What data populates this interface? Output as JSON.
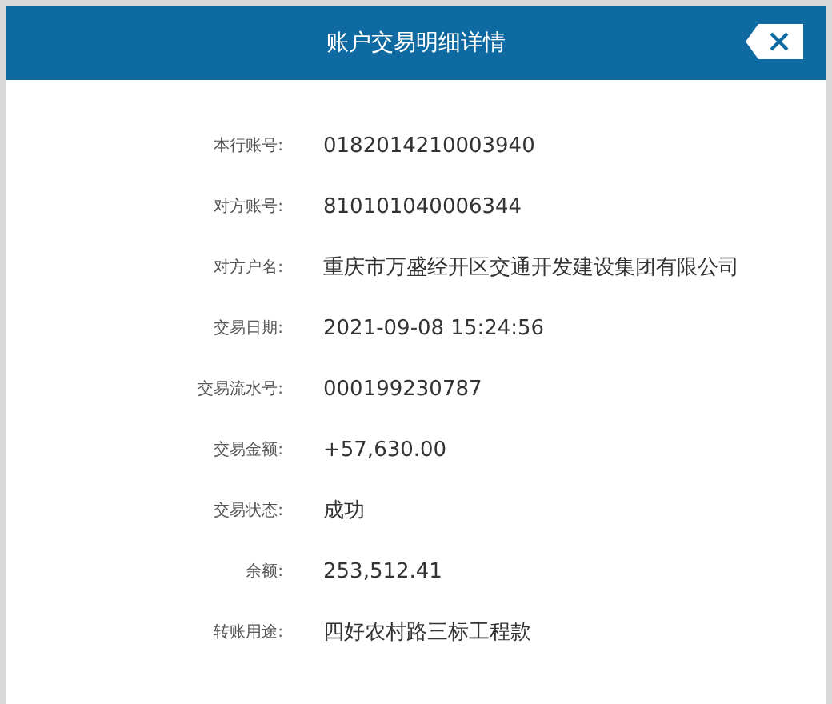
{
  "window": {
    "title": "账户交易明细详情"
  },
  "fields": [
    {
      "label": "本行账号:",
      "value": "0182014210003940"
    },
    {
      "label": "对方账号:",
      "value": "810101040006344"
    },
    {
      "label": "对方户名:",
      "value": "重庆市万盛经开区交通开发建设集团有限公司"
    },
    {
      "label": "交易日期:",
      "value": "2021-09-08 15:24:56"
    },
    {
      "label": "交易流水号:",
      "value": "000199230787"
    },
    {
      "label": "交易金额:",
      "value": "+57,630.00"
    },
    {
      "label": "交易状态:",
      "value": "成功"
    },
    {
      "label": "余额:",
      "value": "253,512.41"
    },
    {
      "label": "转账用途:",
      "value": "四好农村路三标工程款"
    }
  ]
}
